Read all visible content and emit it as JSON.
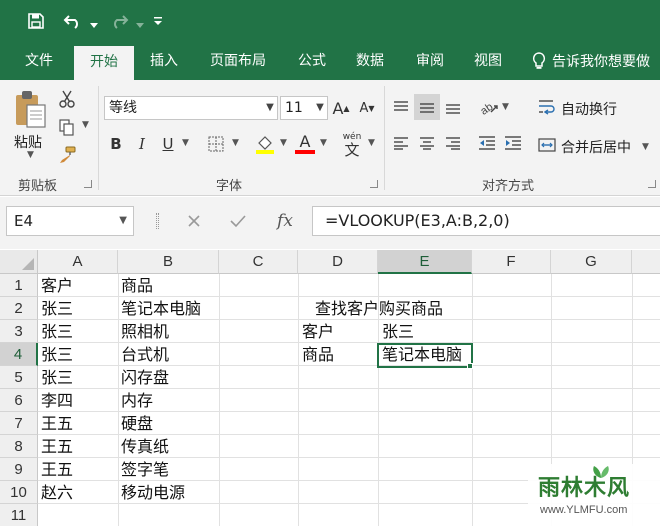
{
  "ribbon_tabs": [
    "文件",
    "开始",
    "插入",
    "页面布局",
    "公式",
    "数据",
    "审阅",
    "视图"
  ],
  "tell_me": "告诉我你想要做",
  "clipboard": {
    "paste_label": "粘贴",
    "group_label": "剪贴板"
  },
  "font": {
    "name": "等线",
    "size": "11",
    "group_label": "字体",
    "wen": "wén",
    "wen_char": "文"
  },
  "alignment": {
    "wrap_label": "自动换行",
    "merge_label": "合并后居中",
    "group_label": "对齐方式"
  },
  "colors": {
    "accent": "#217346",
    "highlight": "#ffff00",
    "font_color": "#ff0000"
  },
  "formula_bar": {
    "name_box": "E4",
    "fx": "fx",
    "formula": "=VLOOKUP(E3,A:B,2,0)"
  },
  "columns": [
    "A",
    "B",
    "C",
    "D",
    "E",
    "F",
    "G"
  ],
  "rows": [
    "1",
    "2",
    "3",
    "4",
    "5",
    "6",
    "7",
    "8",
    "9",
    "10",
    "11"
  ],
  "selected": {
    "column": "E",
    "row": "4"
  },
  "cells": {
    "A1": "客户",
    "B1": "商品",
    "A2": "张三",
    "B2": "笔记本电脑",
    "D2": "查找客户购买商品",
    "A3": "张三",
    "B3": "照相机",
    "D3": "客户",
    "E3": "张三",
    "A4": "张三",
    "B4": "台式机",
    "D4": "商品",
    "E4": "笔记本电脑",
    "A5": "张三",
    "B5": "闪存盘",
    "A6": "李四",
    "B6": "内存",
    "A7": "王五",
    "B7": "硬盘",
    "A8": "王五",
    "B8": "传真纸",
    "A9": "王五",
    "B9": "签字笔",
    "A10": "赵六",
    "B10": "移动电源"
  },
  "watermark": {
    "title": "雨林木风",
    "url": "www.YLMFU.com"
  }
}
